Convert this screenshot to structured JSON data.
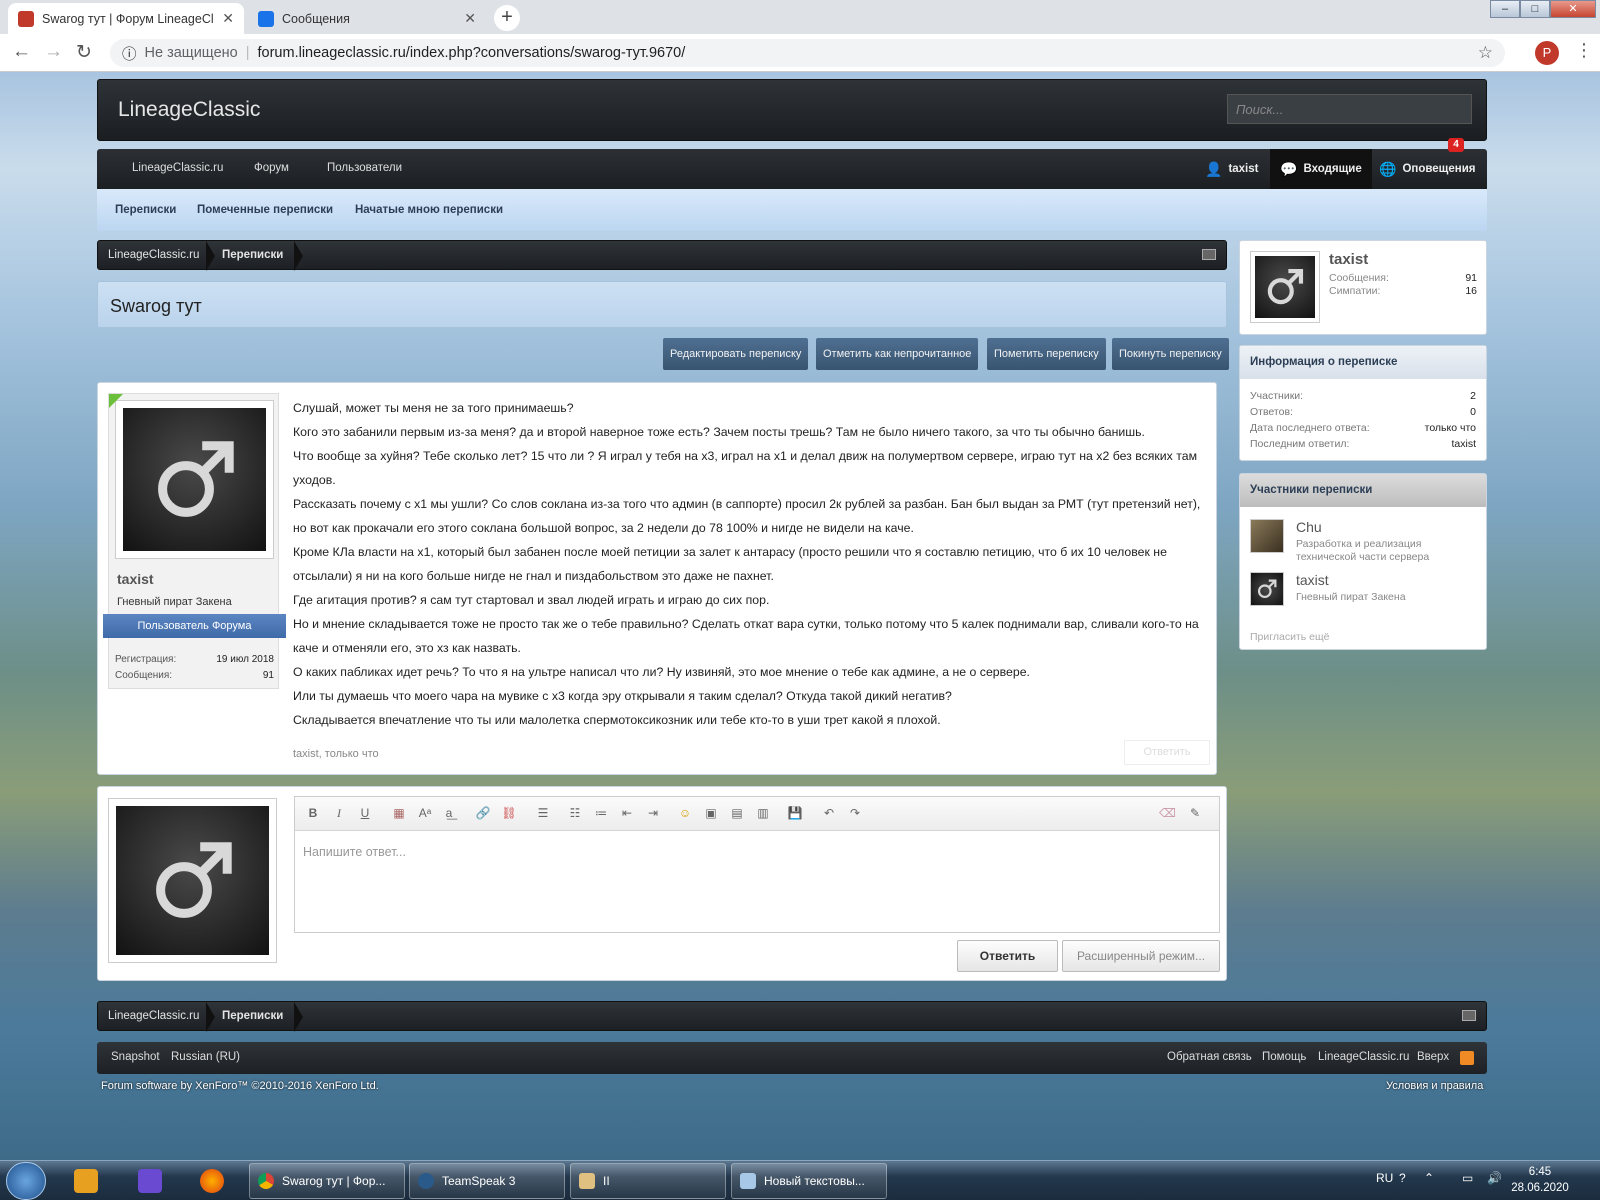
{
  "browser": {
    "tabs": [
      {
        "title": "Swarog тут | Форум LineageClassic"
      },
      {
        "title": "Сообщения"
      }
    ],
    "security": "Не защищено",
    "url": "forum.lineageclassic.ru/index.php?conversations/swarog-тут.9670/",
    "profile_letter": "P"
  },
  "header": {
    "logo": "LineageClassic",
    "search_placeholder": "Поиск..."
  },
  "navbar": {
    "left": [
      "LineageClassic.ru",
      "Форум",
      "Пользователи"
    ],
    "user": "taxist",
    "inbox": "Входящие",
    "alerts": "Оповещения",
    "alerts_badge": "4"
  },
  "subnav": [
    "Переписки",
    "Помеченные переписки",
    "Начатые мною переписки"
  ],
  "breadcrumb": [
    "LineageClassic.ru",
    "Переписки"
  ],
  "page_title": "Swarog тут",
  "actions": [
    "Редактировать переписку",
    "Отметить как непрочитанное",
    "Пометить переписку",
    "Покинуть переписку"
  ],
  "message": {
    "author": "taxist",
    "author_title": "Гневный пират Закена",
    "role": "Пользователь Форума",
    "reg_label": "Регистрация:",
    "reg_value": "19 июл 2018",
    "msgs_label": "Сообщения:",
    "msgs_value": "91",
    "lines": [
      "Слушай, может ты меня не за того принимаешь?",
      "Кого это забанили первым из-за меня? да и второй наверное тоже есть? Зачем посты трешь? Там не было ничего такого, за что ты обычно банишь.",
      "Что вообще за хуйня? Тебе сколько лет? 15 что ли ? Я играл у тебя на х3, играл на х1 и делал движ на полумертвом сервере, играю тут на х2 без всяких там уходов.",
      "Рассказать почему с х1 мы ушли? Со слов соклана из-за того что админ (в саппорте) просил 2к рублей за разбан. Бан был выдан за РМТ (тут претензий нет), но вот как прокачали его этого соклана большой вопрос, за 2 недели до 78 100% и нигде не видели на каче.",
      "Кроме КЛа власти на х1, который был забанен после моей петиции за залет к антарасу (просто решили что я составлю петицию, что б их 10 человек не отсылали) я ни на кого больше нигде не гнал и пиздабольством это даже не пахнет.",
      "Где агитация против? я сам тут стартовал и звал людей играть и играю до сих пор.",
      "Но и мнение складывается тоже не просто так же о тебе правильно? Сделать откат вара сутки, только потому что 5 калек поднимали вар, сливали кого-то на каче и отменяли его, это хз как назвать.",
      "О каких пабликах идет речь? То что я на ультре написал что ли? Ну извиняй, это мое мнение о тебе как админе, а не о сервере.",
      "Или ты думаешь что моего чара на мувике с х3 когда эру открывали я таким сделал? Откуда такой дикий негатив?",
      "Складывается впечатление что ты или малолетка спермотоксикозник или тебе кто-то в уши трет какой я плохой."
    ],
    "meta": "taxist, только что",
    "reply_link": "Ответить"
  },
  "quick_reply": {
    "placeholder": "Напишите ответ...",
    "submit": "Ответить",
    "advanced": "Расширенный режим..."
  },
  "sidebar": {
    "user": {
      "name": "taxist",
      "msgs_label": "Сообщения:",
      "msgs": "91",
      "likes_label": "Симпатии:",
      "likes": "16"
    },
    "info": {
      "title": "Информация о переписке",
      "rows": [
        {
          "k": "Участники:",
          "v": "2"
        },
        {
          "k": "Ответов:",
          "v": "0"
        },
        {
          "k": "Дата последнего ответа:",
          "v": "только что"
        },
        {
          "k": "Последним ответил:",
          "v": "taxist"
        }
      ]
    },
    "participants": {
      "title": "Участники переписки",
      "list": [
        {
          "name": "Chu",
          "desc": "Разработка и реализация технической части сервера"
        },
        {
          "name": "taxist",
          "desc": "Гневный пират Закена"
        }
      ],
      "invite": "Пригласить ещё"
    }
  },
  "footer": {
    "left": [
      "Snapshot",
      "Russian (RU)"
    ],
    "right": [
      "Обратная связь",
      "Помощь",
      "LineageClassic.ru",
      "Вверх"
    ],
    "copyright": "Forum software by XenForo™ ©2010-2016 XenForo Ltd.",
    "terms": "Условия и правила"
  },
  "taskbar": {
    "tasks": [
      "Swarog тут | Фор...",
      "TeamSpeak 3",
      "II",
      "Новый текстовы..."
    ],
    "lang": "RU",
    "time": "6:45",
    "date": "28.06.2020"
  },
  "colors": {
    "accent": "#3f6aa8",
    "nav_dark": "#1d2024",
    "badge": "#dd2222",
    "online": "#6bbf3a"
  }
}
